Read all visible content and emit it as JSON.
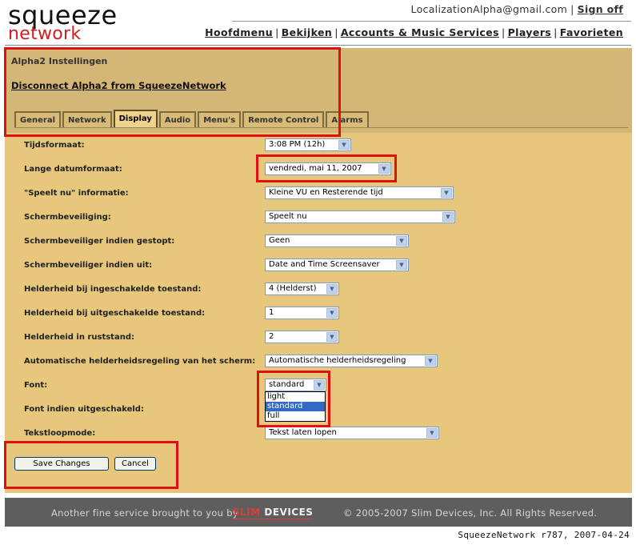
{
  "logo": {
    "top": "squeeze",
    "bottom": "network"
  },
  "account": {
    "email": "LocalizationAlpha@gmail.com",
    "sep": "|",
    "signoff": "Sign off"
  },
  "nav": [
    "Hoofdmenu",
    "Bekijken",
    "Accounts & Music Services",
    "Players",
    "Favorieten"
  ],
  "nav_sep": "|",
  "panel": {
    "title": "Alpha2 Instellingen",
    "disconnect": "Disconnect Alpha2 from SqueezeNetwork",
    "tabs": [
      "General",
      "Network",
      "Display",
      "Audio",
      "Menu's",
      "Remote Control",
      "Alarms"
    ],
    "active_tab": "Display"
  },
  "settings": [
    {
      "label": "Tijdsformaat:",
      "value": "3:08 PM (12h)"
    },
    {
      "label": "Lange datumformaat:",
      "value": "vendredi, mai 11, 2007"
    },
    {
      "label": "\"Speelt nu\" informatie:",
      "value": "Kleine VU en Resterende tijd"
    },
    {
      "label": "Schermbeveiliging:",
      "value": "Speelt nu"
    },
    {
      "label": "Schermbeveiliger indien gestopt:",
      "value": "Geen"
    },
    {
      "label": "Schermbeveiliger indien uit:",
      "value": "Date and Time Screensaver"
    },
    {
      "label": "Helderheid bij ingeschakelde toestand:",
      "value": "4 (Helderst)"
    },
    {
      "label": "Helderheid bij uitgeschakelde toestand:",
      "value": "1"
    },
    {
      "label": "Helderheid in ruststand:",
      "value": "2"
    },
    {
      "label": "Automatische helderheidsregeling van het scherm:",
      "value": "Automatische helderheidsregeling"
    },
    {
      "label": "Font:",
      "value": "standard"
    },
    {
      "label": "Font indien uitgeschakeld:",
      "value": ""
    },
    {
      "label": "Tekstloopmode:",
      "value": "Tekst laten lopen"
    }
  ],
  "font_dropdown": {
    "options": [
      "light",
      "standard",
      "full"
    ],
    "selected": "standard"
  },
  "buttons": {
    "save": "Save Changes",
    "cancel": "Cancel"
  },
  "footer": {
    "tagline": "Another fine service brought to you by",
    "brand_slim": "SLIM",
    "brand_devices": " DEVICES",
    "copyright": "© 2005-2007 Slim Devices, Inc. All Rights Reserved."
  },
  "version": "SqueezeNetwork r787, 2007-04-24",
  "colors": {
    "panel": "#e7c77c",
    "header": "#d4b777",
    "highlight": "#e01010",
    "footer": "#5e5e5e",
    "accent_red": "#d21e1e"
  }
}
